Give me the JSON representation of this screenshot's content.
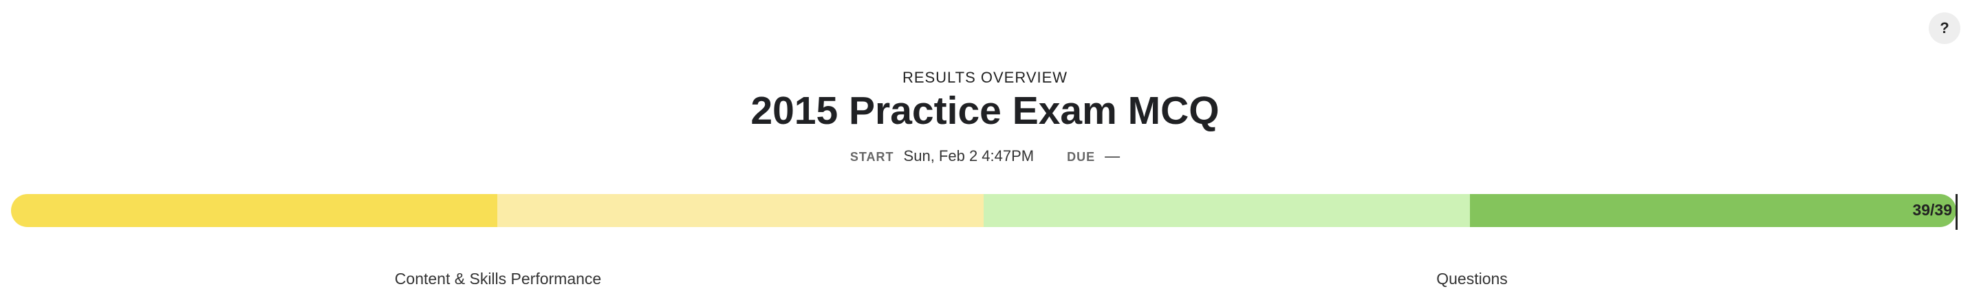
{
  "header": {
    "help_label": "?",
    "overview_label": "RESULTS OVERVIEW",
    "title": "2015 Practice Exam MCQ"
  },
  "meta": {
    "start_label": "START",
    "start_value": "Sun, Feb 2 4:47PM",
    "due_label": "DUE",
    "due_value": "—"
  },
  "progress": {
    "count_text": "39/39",
    "segments": [
      {
        "color": "#f8df55"
      },
      {
        "color": "#fbeca7"
      },
      {
        "color": "#cdf2b6"
      },
      {
        "color": "#84c45c"
      }
    ]
  },
  "tabs": {
    "left": "Content & Skills Performance",
    "right": "Questions"
  }
}
